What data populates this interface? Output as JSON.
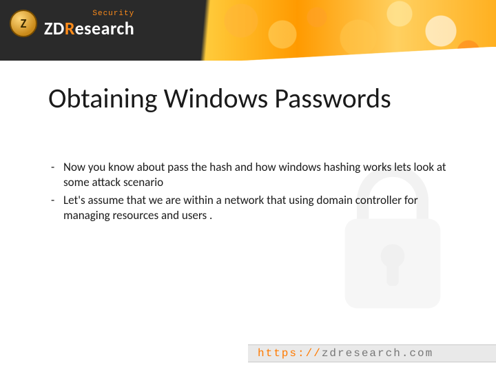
{
  "logo": {
    "security_tag": "Security",
    "brand_prefix": "ZD",
    "brand_highlight": "R",
    "brand_suffix": "esearch",
    "medal_letter": "Z"
  },
  "slide": {
    "title": "Obtaining Windows Passwords",
    "bullets": [
      "Now you know about pass the hash and how windows hashing works lets look at some attack scenario",
      "Let's assume that we are within a network that using domain controller for managing resources and users ."
    ]
  },
  "footer": {
    "scheme": "https://",
    "domain": "zdresearch.com"
  }
}
